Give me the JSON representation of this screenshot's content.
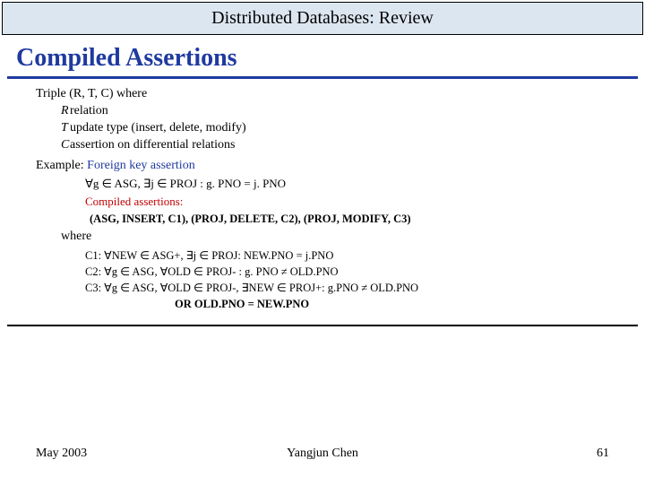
{
  "header": {
    "title": "Distributed Databases: Review"
  },
  "slide": {
    "heading": "Compiled Assertions",
    "triple_label": "Triple (R, T, C) where",
    "defs": {
      "R": {
        "sym": "R",
        "desc": "relation"
      },
      "T": {
        "sym": "T",
        "desc": "update type (insert, delete, modify)"
      },
      "C": {
        "sym": "C",
        "desc": "assertion on differential relations"
      }
    },
    "example_label": "Example:",
    "example_name": "Foreign key assertion",
    "formula1": "∀g ∈ ASG, ∃j ∈ PROJ :  g. PNO = j. PNO",
    "compiled_label": "Compiled assertions:",
    "compiled_list": "(ASG, INSERT, C1), (PROJ, DELETE, C2), (PROJ, MODIFY, C3)",
    "where": "where",
    "C1": "C1: ∀NEW ∈ ASG+, ∃j ∈ PROJ: NEW.PNO = j.PNO",
    "C2": "C2: ∀g ∈ ASG, ∀OLD ∈ PROJ- : g. PNO ≠ OLD.PNO",
    "C3a": "C3: ∀g ∈ ASG, ∀OLD ∈ PROJ-, ∃NEW ∈ PROJ+: g.PNO ≠ OLD.PNO",
    "C3b": "OR OLD.PNO = NEW.PNO"
  },
  "footer": {
    "left": "May 2003",
    "center": "Yangjun Chen",
    "right": "61"
  }
}
